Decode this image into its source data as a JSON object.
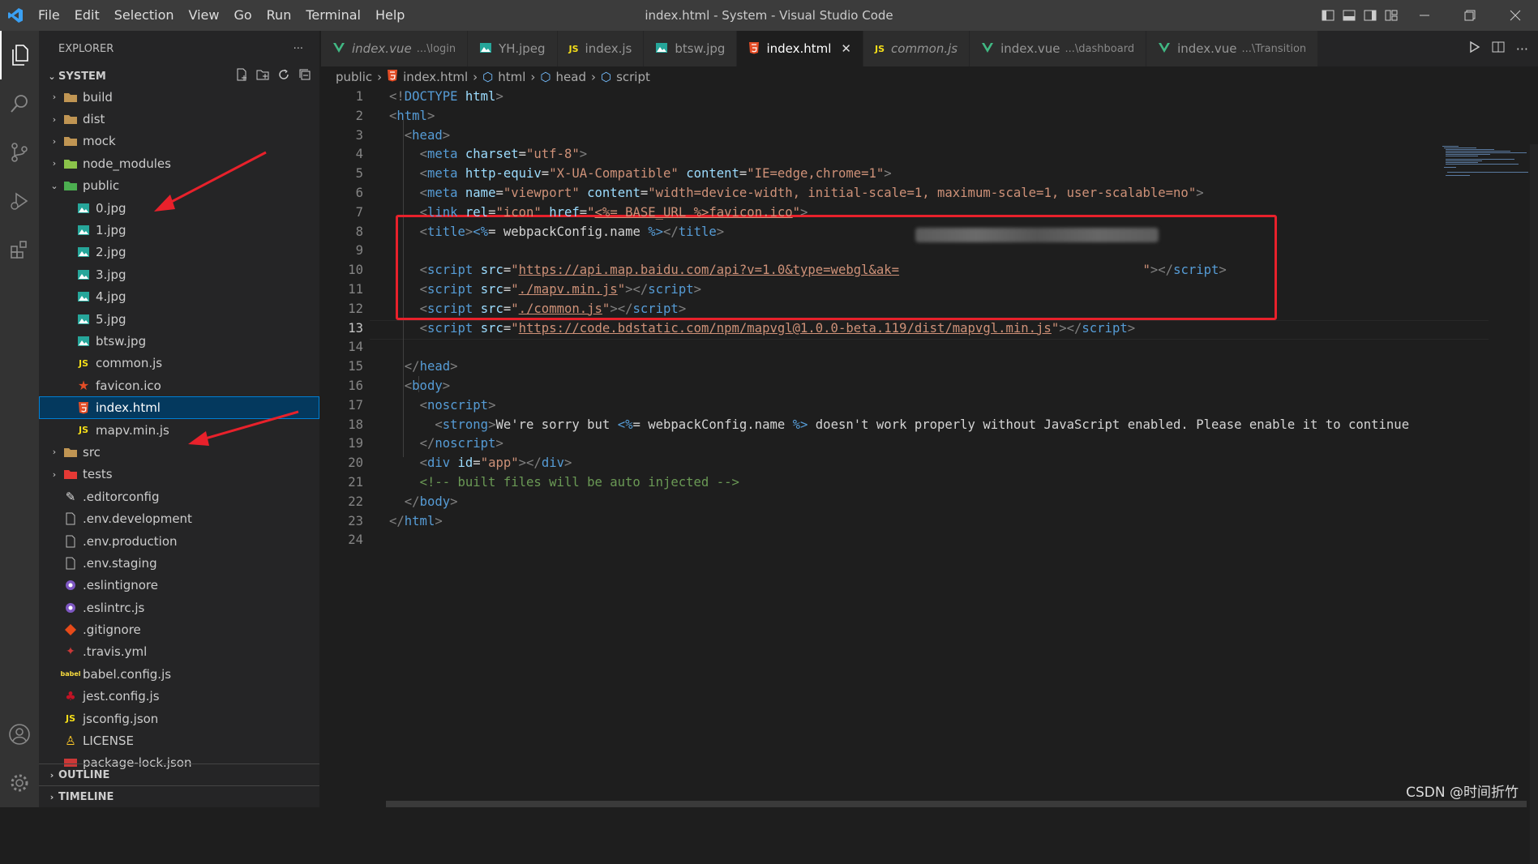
{
  "window": {
    "title": "index.html - System - Visual Studio Code"
  },
  "menu": [
    "File",
    "Edit",
    "Selection",
    "View",
    "Go",
    "Run",
    "Terminal",
    "Help"
  ],
  "explorer": {
    "header": "EXPLORER",
    "folder": "SYSTEM",
    "items": [
      {
        "label": "build",
        "type": "folder",
        "icon": "folder-icon",
        "color": "#c09553",
        "depth": 0,
        "state": "closed"
      },
      {
        "label": "dist",
        "type": "folder",
        "icon": "folder-icon",
        "color": "#c09553",
        "depth": 0,
        "state": "closed"
      },
      {
        "label": "mock",
        "type": "folder",
        "icon": "folder-icon",
        "color": "#c09553",
        "depth": 0,
        "state": "closed"
      },
      {
        "label": "node_modules",
        "type": "folder",
        "icon": "node-folder-icon",
        "color": "#8bc34a",
        "depth": 0,
        "state": "closed"
      },
      {
        "label": "public",
        "type": "folder",
        "icon": "public-folder-icon",
        "color": "#4caf50",
        "depth": 0,
        "state": "open"
      },
      {
        "label": "0.jpg",
        "type": "file",
        "icon": "image-icon",
        "color": "#26a69a",
        "depth": 1
      },
      {
        "label": "1.jpg",
        "type": "file",
        "icon": "image-icon",
        "color": "#26a69a",
        "depth": 1
      },
      {
        "label": "2.jpg",
        "type": "file",
        "icon": "image-icon",
        "color": "#26a69a",
        "depth": 1
      },
      {
        "label": "3.jpg",
        "type": "file",
        "icon": "image-icon",
        "color": "#26a69a",
        "depth": 1
      },
      {
        "label": "4.jpg",
        "type": "file",
        "icon": "image-icon",
        "color": "#26a69a",
        "depth": 1
      },
      {
        "label": "5.jpg",
        "type": "file",
        "icon": "image-icon",
        "color": "#26a69a",
        "depth": 1
      },
      {
        "label": "btsw.jpg",
        "type": "file",
        "icon": "image-icon",
        "color": "#26a69a",
        "depth": 1
      },
      {
        "label": "common.js",
        "type": "file",
        "icon": "js-icon",
        "color": "#f5de19",
        "depth": 1
      },
      {
        "label": "favicon.ico",
        "type": "file",
        "icon": "star-icon",
        "color": "#e44d26",
        "depth": 1
      },
      {
        "label": "index.html",
        "type": "file",
        "icon": "html-icon",
        "color": "#e44d26",
        "depth": 1,
        "selected": true
      },
      {
        "label": "mapv.min.js",
        "type": "file",
        "icon": "js-icon",
        "color": "#f5de19",
        "depth": 1
      },
      {
        "label": "src",
        "type": "folder",
        "icon": "folder-icon",
        "color": "#c09553",
        "depth": 0,
        "state": "closed"
      },
      {
        "label": "tests",
        "type": "folder",
        "icon": "tests-folder-icon",
        "color": "#e53935",
        "depth": 0,
        "state": "closed"
      },
      {
        "label": ".editorconfig",
        "type": "file",
        "icon": "editorconfig-icon",
        "color": "#ddd",
        "depth": 0
      },
      {
        "label": ".env.development",
        "type": "file",
        "icon": "file-icon",
        "color": "#bbb",
        "depth": 0
      },
      {
        "label": ".env.production",
        "type": "file",
        "icon": "file-icon",
        "color": "#bbb",
        "depth": 0
      },
      {
        "label": ".env.staging",
        "type": "file",
        "icon": "file-icon",
        "color": "#bbb",
        "depth": 0
      },
      {
        "label": ".eslintignore",
        "type": "file",
        "icon": "eslint-icon",
        "color": "#7e57c2",
        "depth": 0
      },
      {
        "label": ".eslintrc.js",
        "type": "file",
        "icon": "eslint-icon",
        "color": "#7e57c2",
        "depth": 0
      },
      {
        "label": ".gitignore",
        "type": "file",
        "icon": "git-icon",
        "color": "#e64a19",
        "depth": 0
      },
      {
        "label": ".travis.yml",
        "type": "file",
        "icon": "travis-icon",
        "color": "#cb3837",
        "depth": 0
      },
      {
        "label": "babel.config.js",
        "type": "file",
        "icon": "babel-icon",
        "color": "#f9dc3e",
        "depth": 0
      },
      {
        "label": "jest.config.js",
        "type": "file",
        "icon": "jest-icon",
        "color": "#c21325",
        "depth": 0
      },
      {
        "label": "jsconfig.json",
        "type": "file",
        "icon": "js-icon",
        "color": "#f5de19",
        "depth": 0
      },
      {
        "label": "LICENSE",
        "type": "file",
        "icon": "license-icon",
        "color": "#ffca28",
        "depth": 0
      },
      {
        "label": "package-lock.json",
        "type": "file",
        "icon": "npm-icon",
        "color": "#cb3837",
        "depth": 0
      }
    ],
    "outline": "OUTLINE",
    "timeline": "TIMELINE"
  },
  "tabs": [
    {
      "label": "index.vue",
      "sub": "...\\login",
      "icon": "vue-icon",
      "color": "#41b883",
      "italic": true
    },
    {
      "label": "YH.jpeg",
      "sub": "",
      "icon": "image-icon",
      "color": "#26a69a"
    },
    {
      "label": "index.js",
      "sub": "",
      "icon": "js-icon",
      "color": "#f5de19"
    },
    {
      "label": "btsw.jpg",
      "sub": "",
      "icon": "image-icon",
      "color": "#26a69a"
    },
    {
      "label": "index.html",
      "sub": "",
      "icon": "html-icon",
      "color": "#e44d26",
      "active": true
    },
    {
      "label": "common.js",
      "sub": "",
      "icon": "js-icon",
      "color": "#f5de19",
      "italic": true
    },
    {
      "label": "index.vue",
      "sub": "...\\dashboard",
      "icon": "vue-icon",
      "color": "#41b883"
    },
    {
      "label": "index.vue",
      "sub": "...\\Transition",
      "icon": "vue-icon",
      "color": "#41b883"
    }
  ],
  "breadcrumb": [
    "public",
    "index.html",
    "html",
    "head",
    "script"
  ],
  "code": {
    "current_line": 13,
    "lines": [
      [
        [
          "p",
          "<!"
        ],
        [
          "t",
          "DOCTYPE"
        ],
        [
          "x",
          " "
        ],
        [
          "a",
          "html"
        ],
        [
          "p",
          ">"
        ]
      ],
      [
        [
          "p",
          "<"
        ],
        [
          "t",
          "html"
        ],
        [
          "p",
          ">"
        ]
      ],
      [
        [
          "x",
          "  "
        ],
        [
          "p",
          "<"
        ],
        [
          "t",
          "head"
        ],
        [
          "p",
          ">"
        ]
      ],
      [
        [
          "x",
          "    "
        ],
        [
          "p",
          "<"
        ],
        [
          "t",
          "meta"
        ],
        [
          "x",
          " "
        ],
        [
          "a",
          "charset"
        ],
        [
          "x",
          "="
        ],
        [
          "s",
          "\"utf-8\""
        ],
        [
          "p",
          ">"
        ]
      ],
      [
        [
          "x",
          "    "
        ],
        [
          "p",
          "<"
        ],
        [
          "t",
          "meta"
        ],
        [
          "x",
          " "
        ],
        [
          "a",
          "http-equiv"
        ],
        [
          "x",
          "="
        ],
        [
          "s",
          "\"X-UA-Compatible\""
        ],
        [
          "x",
          " "
        ],
        [
          "a",
          "content"
        ],
        [
          "x",
          "="
        ],
        [
          "s",
          "\"IE=edge,chrome=1\""
        ],
        [
          "p",
          ">"
        ]
      ],
      [
        [
          "x",
          "    "
        ],
        [
          "p",
          "<"
        ],
        [
          "t",
          "meta"
        ],
        [
          "x",
          " "
        ],
        [
          "a",
          "name"
        ],
        [
          "x",
          "="
        ],
        [
          "s",
          "\"viewport\""
        ],
        [
          "x",
          " "
        ],
        [
          "a",
          "content"
        ],
        [
          "x",
          "="
        ],
        [
          "s",
          "\"width=device-width, initial-scale=1, maximum-scale=1, user-scalable=no\""
        ],
        [
          "p",
          ">"
        ]
      ],
      [
        [
          "x",
          "    "
        ],
        [
          "p",
          "<"
        ],
        [
          "t",
          "link"
        ],
        [
          "x",
          " "
        ],
        [
          "a",
          "rel"
        ],
        [
          "x",
          "="
        ],
        [
          "s",
          "\"icon\""
        ],
        [
          "x",
          " "
        ],
        [
          "a",
          "href"
        ],
        [
          "x",
          "="
        ],
        [
          "s",
          "\""
        ],
        [
          "su",
          "<%= BASE_URL %>favicon.ico"
        ],
        [
          "s",
          "\""
        ],
        [
          "p",
          ">"
        ]
      ],
      [
        [
          "x",
          "    "
        ],
        [
          "p",
          "<"
        ],
        [
          "t",
          "title"
        ],
        [
          "p",
          ">"
        ],
        [
          "t",
          "<%"
        ],
        [
          "x",
          "= webpackConfig.name "
        ],
        [
          "t",
          "%>"
        ],
        [
          "p",
          "</"
        ],
        [
          "t",
          "title"
        ],
        [
          "p",
          ">"
        ]
      ],
      [],
      [
        [
          "x",
          "    "
        ],
        [
          "p",
          "<"
        ],
        [
          "t",
          "script"
        ],
        [
          "x",
          " "
        ],
        [
          "a",
          "src"
        ],
        [
          "x",
          "="
        ],
        [
          "s",
          "\""
        ],
        [
          "su",
          "https://api.map.baidu.com/api?v=1.0&type=webgl&ak="
        ],
        [
          "x",
          "                                "
        ],
        [
          "s",
          "\""
        ],
        [
          "p",
          "></"
        ],
        [
          "t",
          "script"
        ],
        [
          "p",
          ">"
        ]
      ],
      [
        [
          "x",
          "    "
        ],
        [
          "p",
          "<"
        ],
        [
          "t",
          "script"
        ],
        [
          "x",
          " "
        ],
        [
          "a",
          "src"
        ],
        [
          "x",
          "="
        ],
        [
          "s",
          "\""
        ],
        [
          "su",
          "./mapv.min.js"
        ],
        [
          "s",
          "\""
        ],
        [
          "p",
          "></"
        ],
        [
          "t",
          "script"
        ],
        [
          "p",
          ">"
        ]
      ],
      [
        [
          "x",
          "    "
        ],
        [
          "p",
          "<"
        ],
        [
          "t",
          "script"
        ],
        [
          "x",
          " "
        ],
        [
          "a",
          "src"
        ],
        [
          "x",
          "="
        ],
        [
          "s",
          "\""
        ],
        [
          "su",
          "./common.js"
        ],
        [
          "s",
          "\""
        ],
        [
          "p",
          "></"
        ],
        [
          "t",
          "script"
        ],
        [
          "p",
          ">"
        ]
      ],
      [
        [
          "x",
          "    "
        ],
        [
          "p",
          "<"
        ],
        [
          "t",
          "script"
        ],
        [
          "x",
          " "
        ],
        [
          "a",
          "src"
        ],
        [
          "x",
          "="
        ],
        [
          "s",
          "\""
        ],
        [
          "su",
          "https://code.bdstatic.com/npm/mapvgl@1.0.0-beta.119/dist/mapvgl.min.js"
        ],
        [
          "s",
          "\""
        ],
        [
          "p",
          "></"
        ],
        [
          "t",
          "script"
        ],
        [
          "p",
          ">"
        ]
      ],
      [],
      [
        [
          "x",
          "  "
        ],
        [
          "p",
          "</"
        ],
        [
          "t",
          "head"
        ],
        [
          "p",
          ">"
        ]
      ],
      [
        [
          "x",
          "  "
        ],
        [
          "p",
          "<"
        ],
        [
          "t",
          "body"
        ],
        [
          "p",
          ">"
        ]
      ],
      [
        [
          "x",
          "    "
        ],
        [
          "p",
          "<"
        ],
        [
          "t",
          "noscript"
        ],
        [
          "p",
          ">"
        ]
      ],
      [
        [
          "x",
          "      "
        ],
        [
          "p",
          "<"
        ],
        [
          "t",
          "strong"
        ],
        [
          "p",
          ">"
        ],
        [
          "x",
          "We're sorry but "
        ],
        [
          "t",
          "<%"
        ],
        [
          "x",
          "= webpackConfig.name "
        ],
        [
          "t",
          "%>"
        ],
        [
          "x",
          " doesn't work properly without JavaScript enabled. Please enable it to continue"
        ]
      ],
      [
        [
          "x",
          "    "
        ],
        [
          "p",
          "</"
        ],
        [
          "t",
          "noscript"
        ],
        [
          "p",
          ">"
        ]
      ],
      [
        [
          "x",
          "    "
        ],
        [
          "p",
          "<"
        ],
        [
          "t",
          "div"
        ],
        [
          "x",
          " "
        ],
        [
          "a",
          "id"
        ],
        [
          "x",
          "="
        ],
        [
          "s",
          "\"app\""
        ],
        [
          "p",
          "></"
        ],
        [
          "t",
          "div"
        ],
        [
          "p",
          ">"
        ]
      ],
      [
        [
          "x",
          "    "
        ],
        [
          "c",
          "<!-- built files will be auto injected -->"
        ]
      ],
      [
        [
          "x",
          "  "
        ],
        [
          "p",
          "</"
        ],
        [
          "t",
          "body"
        ],
        [
          "p",
          ">"
        ]
      ],
      [
        [
          "p",
          "</"
        ],
        [
          "t",
          "html"
        ],
        [
          "p",
          ">"
        ]
      ],
      []
    ]
  },
  "watermark": "CSDN @时间折竹",
  "colors": {
    "accent": "#007acc",
    "highlight": "#e8212b",
    "arrow": "#e8212b"
  }
}
